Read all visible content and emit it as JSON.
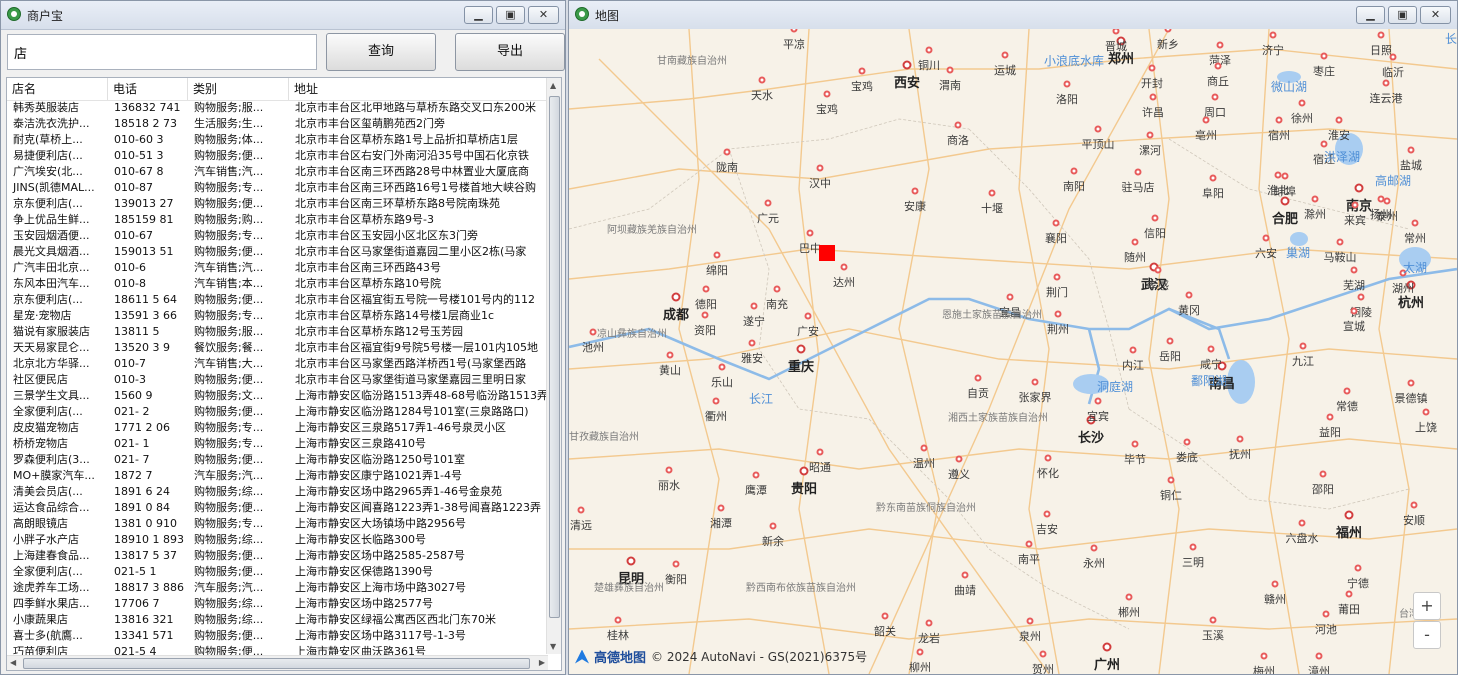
{
  "left_window": {
    "title": "商户宝",
    "search": {
      "value": "店"
    },
    "search_button": "查询",
    "export_button": "导出",
    "columns": [
      "店名",
      "电话",
      "类别",
      "地址"
    ],
    "rows": [
      [
        "韩秀英服装店",
        "136832 741",
        "购物服务;服...",
        "北京市丰台区北甲地路与草桥东路交叉口东200米"
      ],
      [
        "泰洁洗衣洗护...",
        "18518 2 73",
        "生活服务;生...",
        "北京市丰台区玺萌鹏苑西2门旁"
      ],
      [
        "耐克(草桥上...",
        "010-60 3",
        "购物服务;体...",
        "北京市丰台区草桥东路1号上品折扣草桥店1层"
      ],
      [
        "易捷便利店(...",
        "010-51 3",
        "购物服务;便...",
        "北京市丰台区右安门外南河沿35号中国石化京铁"
      ],
      [
        "广汽埃安(北...",
        "010-67 8",
        "汽车销售;汽...",
        "北京市丰台区南三环西路28号中林置业大厦底商"
      ],
      [
        "JINS(凯德MAL...",
        "010-87",
        "购物服务;专...",
        "北京市丰台区南三环西路16号1号楼首地大峡谷购"
      ],
      [
        "京东便利店(...",
        "139013 27",
        "购物服务;便...",
        "北京市丰台区南三环草桥东路8号院南珠苑"
      ],
      [
        "争上优品生鲜...",
        "185159 81",
        "购物服务;购...",
        "北京市丰台区草桥东路9号-3"
      ],
      [
        "玉安园烟酒便...",
        "010-67",
        "购物服务;专...",
        "北京市丰台区玉安园小区北区东3门旁"
      ],
      [
        "晨光文具烟酒...",
        "159013 51",
        "购物服务;便...",
        "北京市丰台区马家堡街道嘉园二里小区2栋(马家"
      ],
      [
        "广汽丰田北京...",
        "010-6",
        "汽车销售;汽...",
        "北京市丰台区南三环西路43号"
      ],
      [
        "东风本田汽车...",
        "010-8",
        "汽车销售;本...",
        "北京市丰台区草桥东路10号院"
      ],
      [
        "京东便利店(...",
        "18611 5 64",
        "购物服务;便...",
        "北京市丰台区福宜街五号院一号楼101号内的112"
      ],
      [
        "星宠·宠物店",
        "13591 3 66",
        "购物服务;专...",
        "北京市丰台区草桥东路14号楼1层商业1c"
      ],
      [
        "猫说有家服装店",
        "13811 5",
        "购物服务;服...",
        "北京市丰台区草桥东路12号玉芳园"
      ],
      [
        "天天易家昆仑...",
        "13520 3 9",
        "餐饮服务;餐...",
        "北京市丰台区福宜街9号院5号楼一层101内105地"
      ],
      [
        "北京北方华驿...",
        "010-7",
        "汽车销售;大...",
        "北京市丰台区马家堡西路洋桥西1号(马家堡西路"
      ],
      [
        "社区便民店",
        "010-3",
        "购物服务;便...",
        "北京市丰台区马家堡街道马家堡嘉园三里明日家"
      ],
      [
        "三景学生文具...",
        "1560 9",
        "购物服务;文...",
        "上海市静安区临汾路1513弄48-68号临汾路1513弄"
      ],
      [
        "全家便利店(...",
        "021- 2",
        "购物服务;便...",
        "上海市静安区临汾路1284号101室(三泉路路口)"
      ],
      [
        "皮皮猫宠物店",
        "1771 2 06",
        "购物服务;专...",
        "上海市静安区三泉路517弄1-46号泉灵小区"
      ],
      [
        "桥桥宠物店",
        "021- 1",
        "购物服务;专...",
        "上海市静安区三泉路410号"
      ],
      [
        "罗森便利店(3...",
        "021- 7",
        "购物服务;便...",
        "上海市静安区临汾路1250号101室"
      ],
      [
        "MO+膜家汽车...",
        "1872 7",
        "汽车服务;汽...",
        "上海市静安区康宁路1021弄1-4号"
      ],
      [
        "清美会员店(...",
        "1891 6 24",
        "购物服务;综...",
        "上海市静安区场中路2965弄1-46号金泉苑"
      ],
      [
        "运达食品综合...",
        "1891 0 84",
        "购物服务;便...",
        "上海市静安区闻喜路1223弄1-38号闻喜路1223弄"
      ],
      [
        "高朗眼镜店",
        "1381 0 910",
        "购物服务;专...",
        "上海市静安区大场镇场中路2956号"
      ],
      [
        "小胖子水产店",
        "18910 1 893",
        "购物服务;综...",
        "上海市静安区长临路300号"
      ],
      [
        "上海建春食品...",
        "13817 5 37",
        "购物服务;便...",
        "上海市静安区场中路2585-2587号"
      ],
      [
        "全家便利店(...",
        "021-5 1",
        "购物服务;便...",
        "上海市静安区保德路1390号"
      ],
      [
        "途虎养车工场...",
        "18817 3 886",
        "汽车服务;汽...",
        "上海市静安区上海市场中路3027号"
      ],
      [
        "四季鲜水果店...",
        "17706 7",
        "购物服务;综...",
        "上海市静安区场中路2577号"
      ],
      [
        "小康蔬果店",
        "13816 321",
        "购物服务;综...",
        "上海市静安区绿福公寓西区西北门东70米"
      ],
      [
        "喜士多(航鷹...",
        "13341 571",
        "购物服务;便...",
        "上海市静安区场中路3117号-1-3号"
      ],
      [
        "巧苗便利店",
        "021-5 4",
        "购物服务;便...",
        "上海市静安区曲沃路361号"
      ]
    ]
  },
  "right_window": {
    "title": "地图",
    "zoom_in": "+",
    "zoom_out": "-",
    "attribution_logo": "高德地图",
    "attribution": "© 2024 AutoNavi - GS(2021)6375号",
    "cities": [
      {
        "name": "郑州",
        "big": true
      },
      {
        "name": "西安",
        "big": true
      },
      {
        "name": "成都",
        "big": true
      },
      {
        "name": "重庆",
        "big": true
      },
      {
        "name": "武汉",
        "big": true
      },
      {
        "name": "长沙",
        "big": true
      },
      {
        "name": "南昌",
        "big": true
      },
      {
        "name": "贵阳",
        "big": true
      },
      {
        "name": "合肥",
        "big": true
      },
      {
        "name": "南京",
        "big": true
      },
      {
        "name": "杭州",
        "big": true
      },
      {
        "name": "福州",
        "big": true
      },
      {
        "name": "昆明",
        "big": true
      },
      {
        "name": "广州",
        "big": true
      },
      {
        "name": "平凉"
      },
      {
        "name": "晋城"
      },
      {
        "name": "新乡"
      },
      {
        "name": "菏泽"
      },
      {
        "name": "济宁"
      },
      {
        "name": "日照"
      },
      {
        "name": "铜川"
      },
      {
        "name": "运城"
      },
      {
        "name": "开封"
      },
      {
        "name": "商丘"
      },
      {
        "name": "枣庄"
      },
      {
        "name": "临沂"
      },
      {
        "name": "宝鸡"
      },
      {
        "name": "渭南"
      },
      {
        "name": "洛阳"
      },
      {
        "name": "天水"
      },
      {
        "name": "宝鸡"
      },
      {
        "name": "许昌"
      },
      {
        "name": "周口"
      },
      {
        "name": "亳州"
      },
      {
        "name": "宿州"
      },
      {
        "name": "徐州"
      },
      {
        "name": "连云港"
      },
      {
        "name": "陇南"
      },
      {
        "name": "商洛"
      },
      {
        "name": "平顶山"
      },
      {
        "name": "漯河"
      },
      {
        "name": "阜阳"
      },
      {
        "name": "淮北"
      },
      {
        "name": "宿迁"
      },
      {
        "name": "淮安"
      },
      {
        "name": "汉中"
      },
      {
        "name": "南阳"
      },
      {
        "name": "驻马店"
      },
      {
        "name": "盐城"
      },
      {
        "name": "安康"
      },
      {
        "name": "十堰"
      },
      {
        "name": "信阳"
      },
      {
        "name": "六安"
      },
      {
        "name": "蚌埠"
      },
      {
        "name": "滁州"
      },
      {
        "name": "扬州"
      },
      {
        "name": "泰州"
      },
      {
        "name": "广元"
      },
      {
        "name": "巴中"
      },
      {
        "name": "襄阳"
      },
      {
        "name": "随州"
      },
      {
        "name": "马鞍山"
      },
      {
        "name": "常州"
      },
      {
        "name": "绵阳"
      },
      {
        "name": "达州"
      },
      {
        "name": "荆门"
      },
      {
        "name": "孝感"
      },
      {
        "name": "芜湖"
      },
      {
        "name": "湖州"
      },
      {
        "name": "德阳"
      },
      {
        "name": "南充"
      },
      {
        "name": "宜昌"
      },
      {
        "name": "黄冈"
      },
      {
        "name": "铜陵"
      },
      {
        "name": "宣城"
      },
      {
        "name": "资阳"
      },
      {
        "name": "遂宁"
      },
      {
        "name": "广安"
      },
      {
        "name": "荆州"
      },
      {
        "name": "池州"
      },
      {
        "name": "雅安"
      },
      {
        "name": "内江"
      },
      {
        "name": "岳阳"
      },
      {
        "name": "咸宁"
      },
      {
        "name": "九江"
      },
      {
        "name": "黄山"
      },
      {
        "name": "乐山"
      },
      {
        "name": "自贡"
      },
      {
        "name": "张家界"
      },
      {
        "name": "常德"
      },
      {
        "name": "景德镇"
      },
      {
        "name": "衢州"
      },
      {
        "name": "宜宾"
      },
      {
        "name": "益阳"
      },
      {
        "name": "上饶"
      },
      {
        "name": "丽水"
      },
      {
        "name": "昭通"
      },
      {
        "name": "遵义"
      },
      {
        "name": "怀化"
      },
      {
        "name": "娄底"
      },
      {
        "name": "抚州"
      },
      {
        "name": "鹰潭"
      },
      {
        "name": "温州"
      },
      {
        "name": "毕节"
      },
      {
        "name": "铜仁"
      },
      {
        "name": "邵阳"
      },
      {
        "name": "湘潭"
      },
      {
        "name": "新余"
      },
      {
        "name": "吉安"
      },
      {
        "name": "南平"
      },
      {
        "name": "六盘水"
      },
      {
        "name": "安顺"
      },
      {
        "name": "衡阳"
      },
      {
        "name": "永州"
      },
      {
        "name": "三明"
      },
      {
        "name": "宁德"
      },
      {
        "name": "曲靖"
      },
      {
        "name": "郴州"
      },
      {
        "name": "赣州"
      },
      {
        "name": "莆田"
      },
      {
        "name": "桂林"
      },
      {
        "name": "韶关"
      },
      {
        "name": "龙岩"
      },
      {
        "name": "泉州"
      },
      {
        "name": "玉溪"
      },
      {
        "name": "河池"
      },
      {
        "name": "柳州"
      },
      {
        "name": "贺州"
      },
      {
        "name": "梅州"
      },
      {
        "name": "漳州"
      },
      {
        "name": "来宾"
      },
      {
        "name": "清远"
      },
      {
        "name": "河源"
      },
      {
        "name": "潮州"
      },
      {
        "name": "汕头"
      },
      {
        "name": "无锡"
      },
      {
        "name": "攀枝花"
      }
    ],
    "regions": [
      "甘南藏族自治州",
      "阿坝藏族羌族自治州",
      "恩施土家族苗族自治州",
      "湘西土家族苗族自治州",
      "黔东南苗族侗族自治州",
      "黔西南布依族苗族自治州",
      "凉山彝族自治州",
      "甘孜藏族自治州",
      "楚雄彝族自治州",
      "台湾海峡"
    ],
    "waters": [
      "小浪底水库",
      "微山湖",
      "洪泽湖",
      "高邮湖",
      "巢湖",
      "太湖",
      "长江",
      "洞庭湖",
      "鄱阳湖",
      "长江"
    ]
  }
}
